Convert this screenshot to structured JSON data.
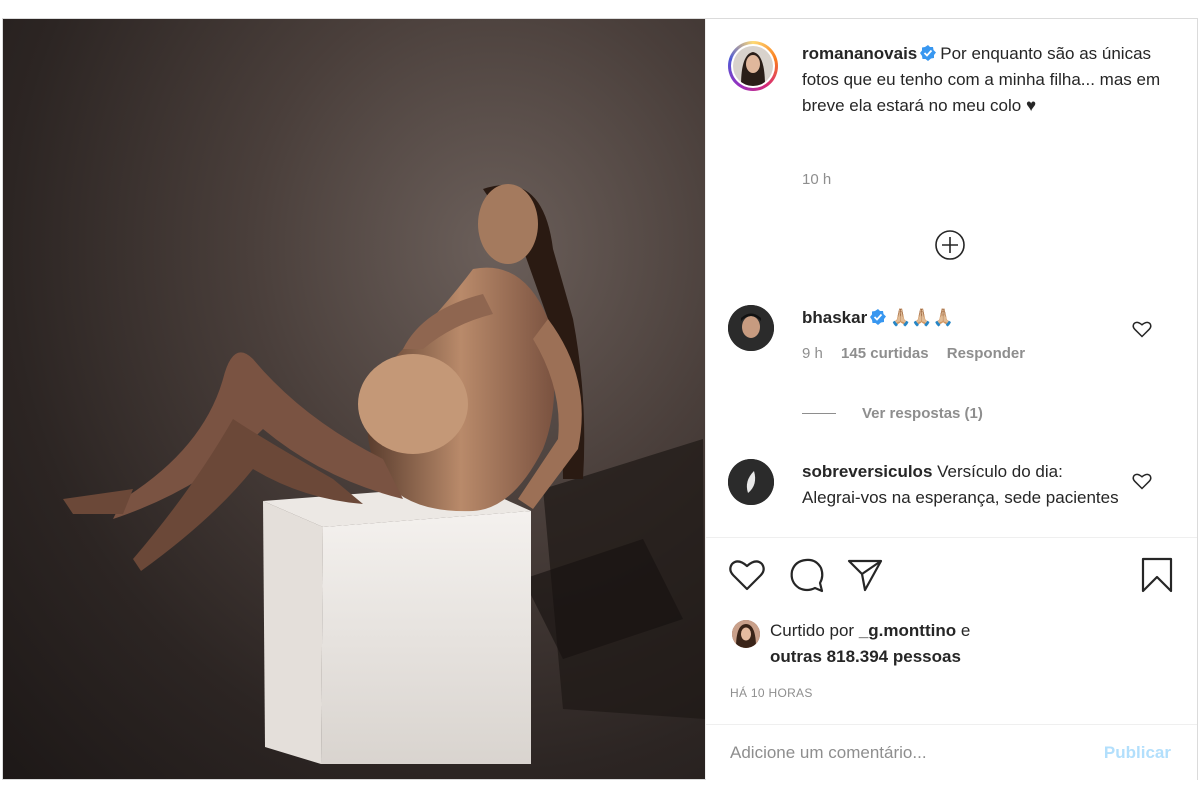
{
  "caption": {
    "username": "romananovais",
    "text": "Por enquanto são as únicas fotos que eu tenho com a minha filha... mas em breve ela estará no meu colo ♥",
    "time": "10 h"
  },
  "comments": [
    {
      "username": "bhaskar",
      "text": "🙏🏼🙏🏼🙏🏼",
      "time": "9 h",
      "likes": "145 curtidas",
      "reply": "Responder",
      "view_replies": "Ver respostas (1)"
    },
    {
      "username": "sobreversiculos",
      "text": "Versículo do dia: Alegrai-vos na esperança, sede pacientes na tribulação"
    }
  ],
  "liked": {
    "prefix": "Curtido por",
    "user": "_g.monttino",
    "conj": "e",
    "others": "outras 818.394 pessoas"
  },
  "timestamp": "HÁ 10 HORAS",
  "comment_box": {
    "placeholder": "Adicione um comentário...",
    "publish": "Publicar"
  },
  "colors": {
    "verified": "#3897f0",
    "publish_disabled": "#b2dffc",
    "muted": "#8e8e8e"
  }
}
